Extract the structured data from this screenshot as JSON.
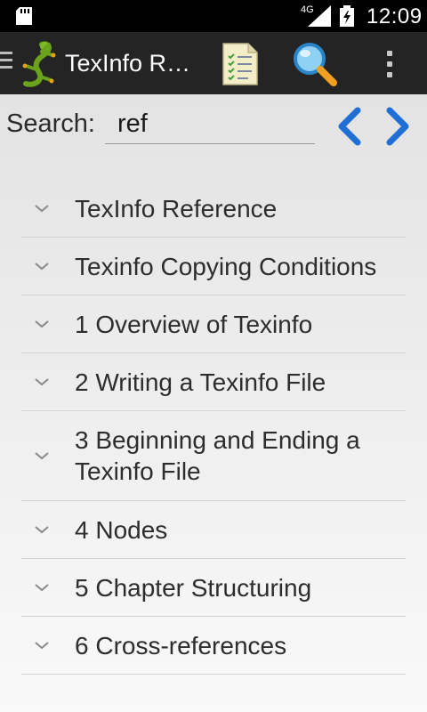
{
  "status_bar": {
    "network_type": "4G",
    "time": "12:09",
    "icons": [
      "sd-card-icon",
      "signal-icon",
      "battery-icon"
    ]
  },
  "action_bar": {
    "title": "TexInfo R…",
    "icons": [
      "menu-icon",
      "gecko-logo-icon",
      "table-of-contents-icon",
      "search-icon",
      "overflow-menu-icon"
    ]
  },
  "search": {
    "label": "Search:",
    "value": "ref"
  },
  "navigation": {
    "prev_icon": "chevron-left-icon",
    "next_icon": "chevron-right-icon",
    "accent_color": "#1f6fd6"
  },
  "toc": {
    "items": [
      {
        "label": "TexInfo Reference"
      },
      {
        "label": "Texinfo Copying Conditions"
      },
      {
        "label": "1 Overview of Texinfo"
      },
      {
        "label": "2 Writing a Texinfo File"
      },
      {
        "label": "3 Beginning and Ending a Texinfo File"
      },
      {
        "label": "4 Nodes"
      },
      {
        "label": "5 Chapter Structuring"
      },
      {
        "label": "6 Cross-references"
      }
    ]
  }
}
